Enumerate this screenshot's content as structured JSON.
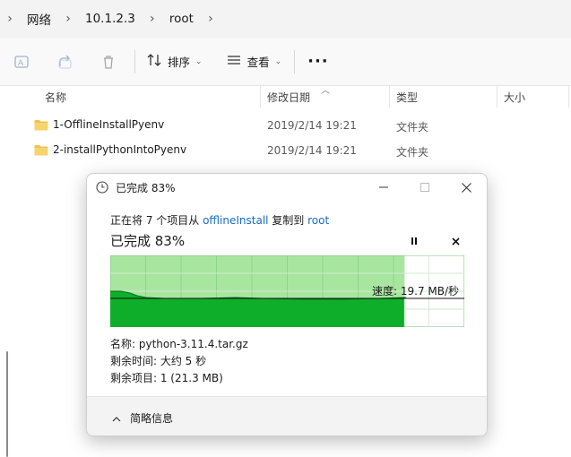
{
  "breadcrumb": {
    "items": [
      "网络",
      "10.1.2.3",
      "root"
    ]
  },
  "toolbar": {
    "sort_label": "排序",
    "view_label": "查看",
    "more_label": "···"
  },
  "columns": {
    "name": "名称",
    "date": "修改日期",
    "type": "类型",
    "size": "大小"
  },
  "files": [
    {
      "name": "1-OfflineInstallPyenv",
      "date": "2019/2/14 19:21",
      "type": "文件夹"
    },
    {
      "name": "2-installPythonIntoPyenv",
      "date": "2019/2/14 19:21",
      "type": "文件夹"
    }
  ],
  "dialog": {
    "title": "已完成 83%",
    "desc_prefix": "正在将 7 个项目从 ",
    "source": "offlineInstall",
    "desc_middle": " 复制到 ",
    "destination": "root",
    "progress_text": "已完成 83%",
    "progress": 0.83,
    "speed": "速度: 19.7 MB/秒",
    "name_line": "名称: python-3.11.4.tar.gz",
    "time_line": "剩余时间: 大约 5 秒",
    "items_line": "剩余项目: 1 (21.3 MB)",
    "details_toggle": "简略信息"
  },
  "colors": {
    "progress_fill_light": "#a8e6a0",
    "progress_fill_dark": "#0fae2a",
    "link": "#1a6cc4",
    "folder": "#f2c14e"
  }
}
